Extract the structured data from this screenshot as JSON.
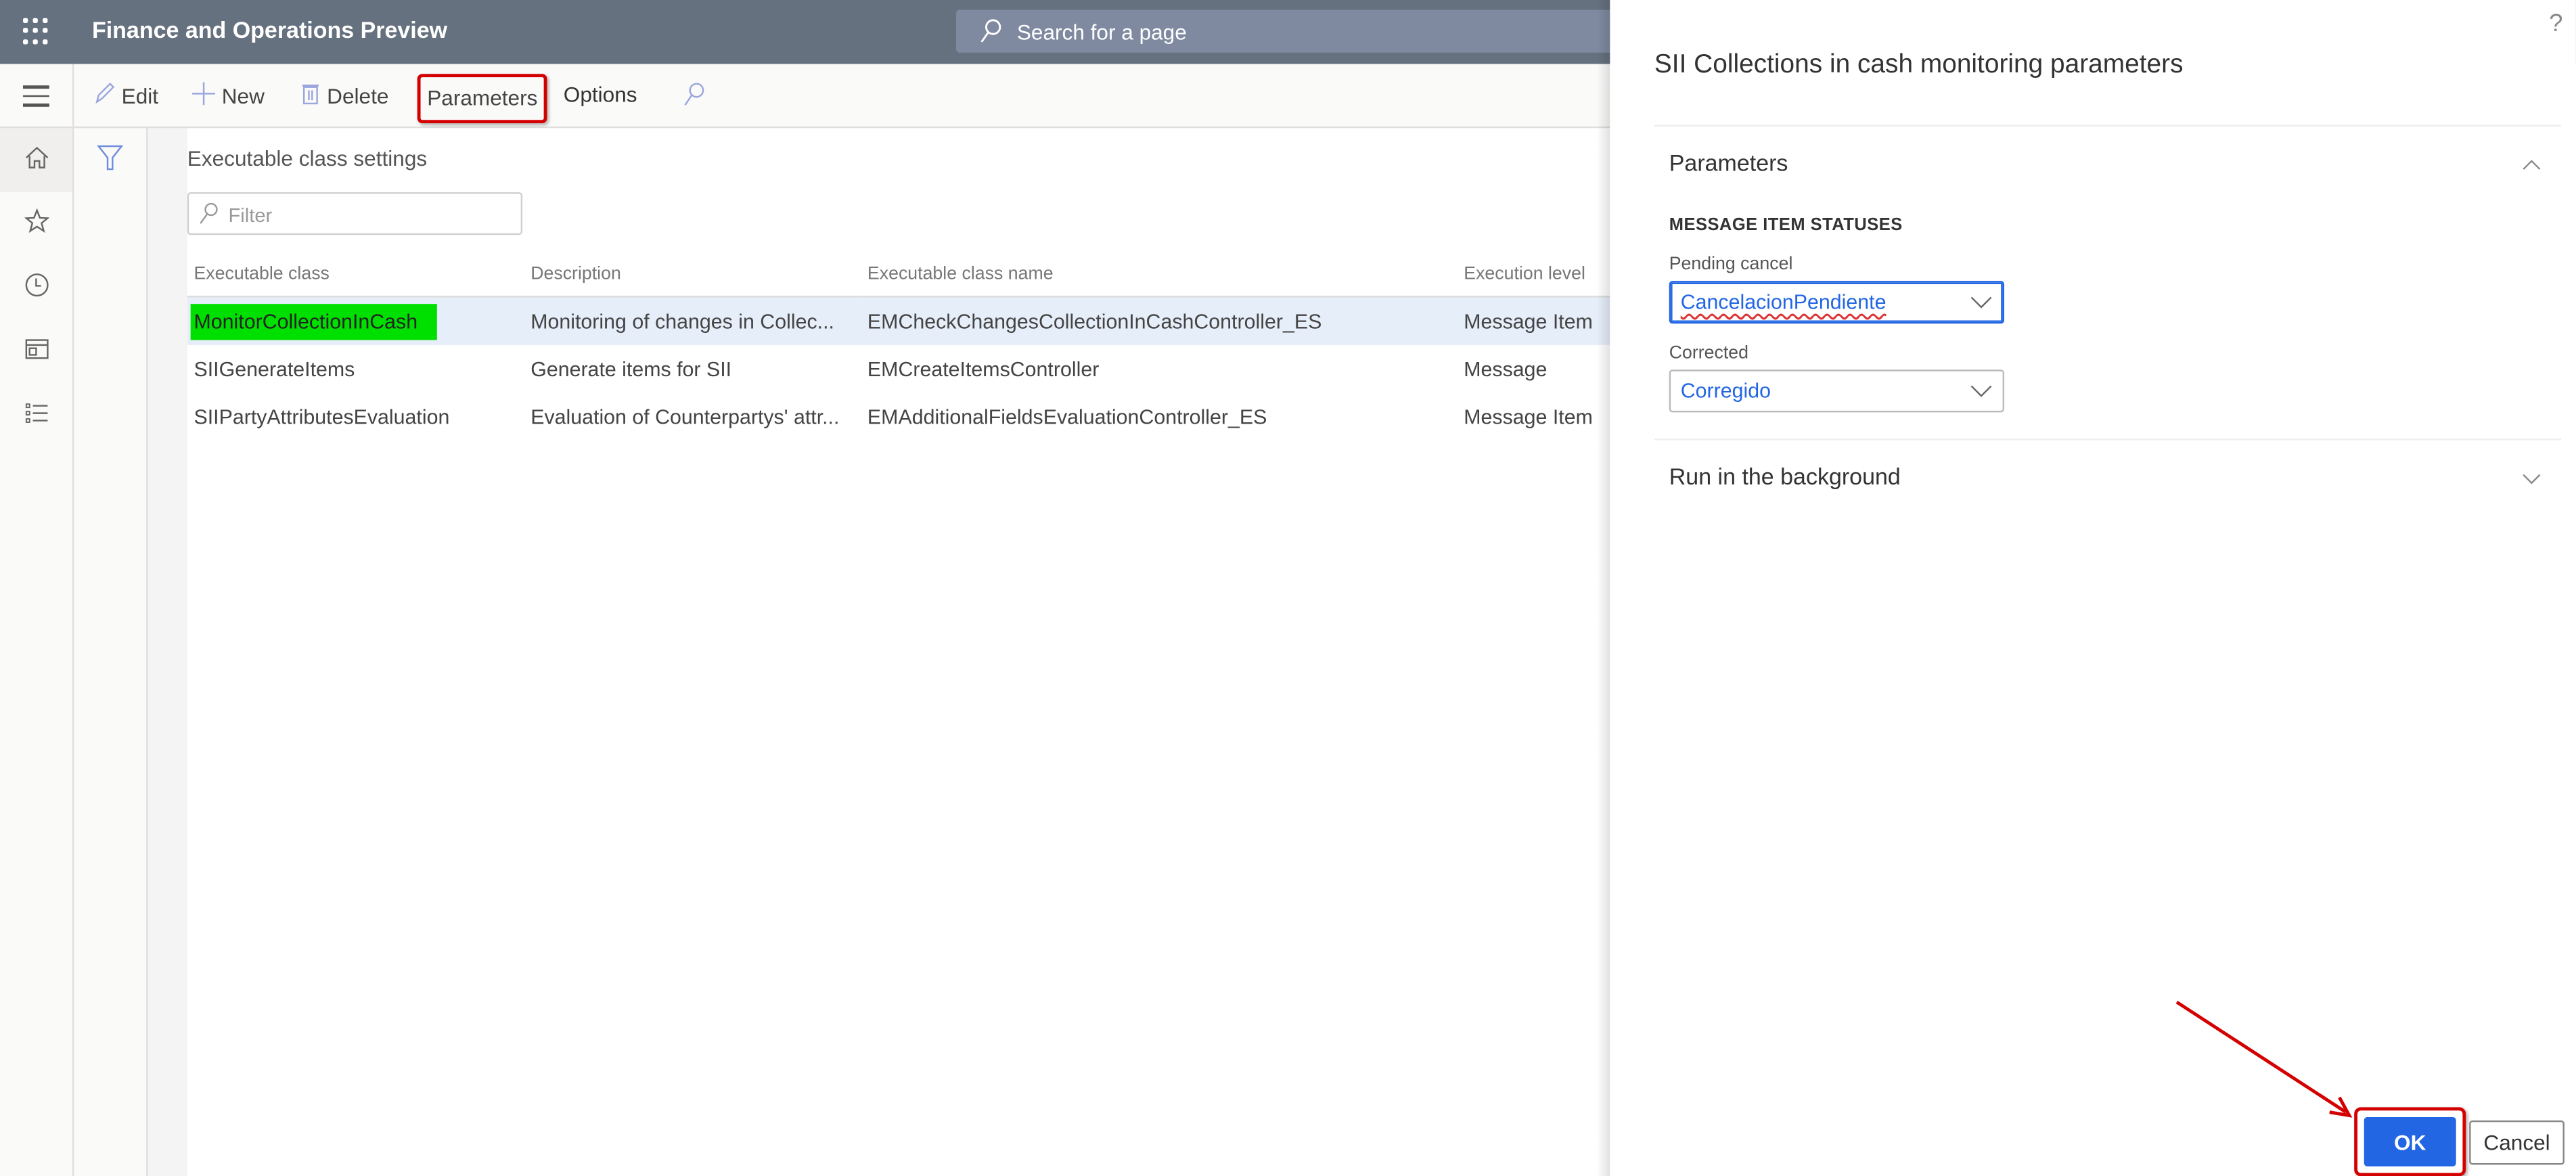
{
  "app": {
    "title": "Finance and Operations Preview",
    "search_placeholder": "Search for a page"
  },
  "toolbar": {
    "edit": "Edit",
    "new": "New",
    "delete": "Delete",
    "parameters": "Parameters",
    "options": "Options"
  },
  "leftnav": {
    "items": [
      "home-icon",
      "favorites-icon",
      "recent-icon",
      "workspaces-icon",
      "modules-icon"
    ]
  },
  "page": {
    "section_title": "Executable class settings",
    "filter_placeholder": "Filter",
    "columns": [
      "Executable class",
      "Description",
      "Executable class name",
      "Execution level"
    ],
    "rows": [
      {
        "executable_class": "MonitorCollectionInCash",
        "description": "Monitoring of changes in Collec...",
        "class_name": "EMCheckChangesCollectionInCashController_ES",
        "execution_level": "Message Item",
        "selected": true
      },
      {
        "executable_class": "SIIGenerateItems",
        "description": "Generate items for SII",
        "class_name": "EMCreateItemsController",
        "execution_level": "Message",
        "selected": false
      },
      {
        "executable_class": "SIIPartyAttributesEvaluation",
        "description": "Evaluation of Counterpartys' attr...",
        "class_name": "EMAdditionalFieldsEvaluationController_ES",
        "execution_level": "Message Item",
        "selected": false
      }
    ]
  },
  "panel": {
    "help": "?",
    "title": "SII Collections in cash monitoring parameters",
    "parameters_tab": "Parameters",
    "group_label": "MESSAGE ITEM STATUSES",
    "pending_cancel_label": "Pending cancel",
    "pending_cancel_value": "CancelacionPendiente",
    "corrected_label": "Corrected",
    "corrected_value": "Corregido",
    "background_tab": "Run in the background",
    "ok": "OK",
    "cancel": "Cancel"
  },
  "colors": {
    "topbar": "#66717f",
    "accent": "#2266e3",
    "highlight": "#00e000",
    "annotation": "#d40000"
  }
}
